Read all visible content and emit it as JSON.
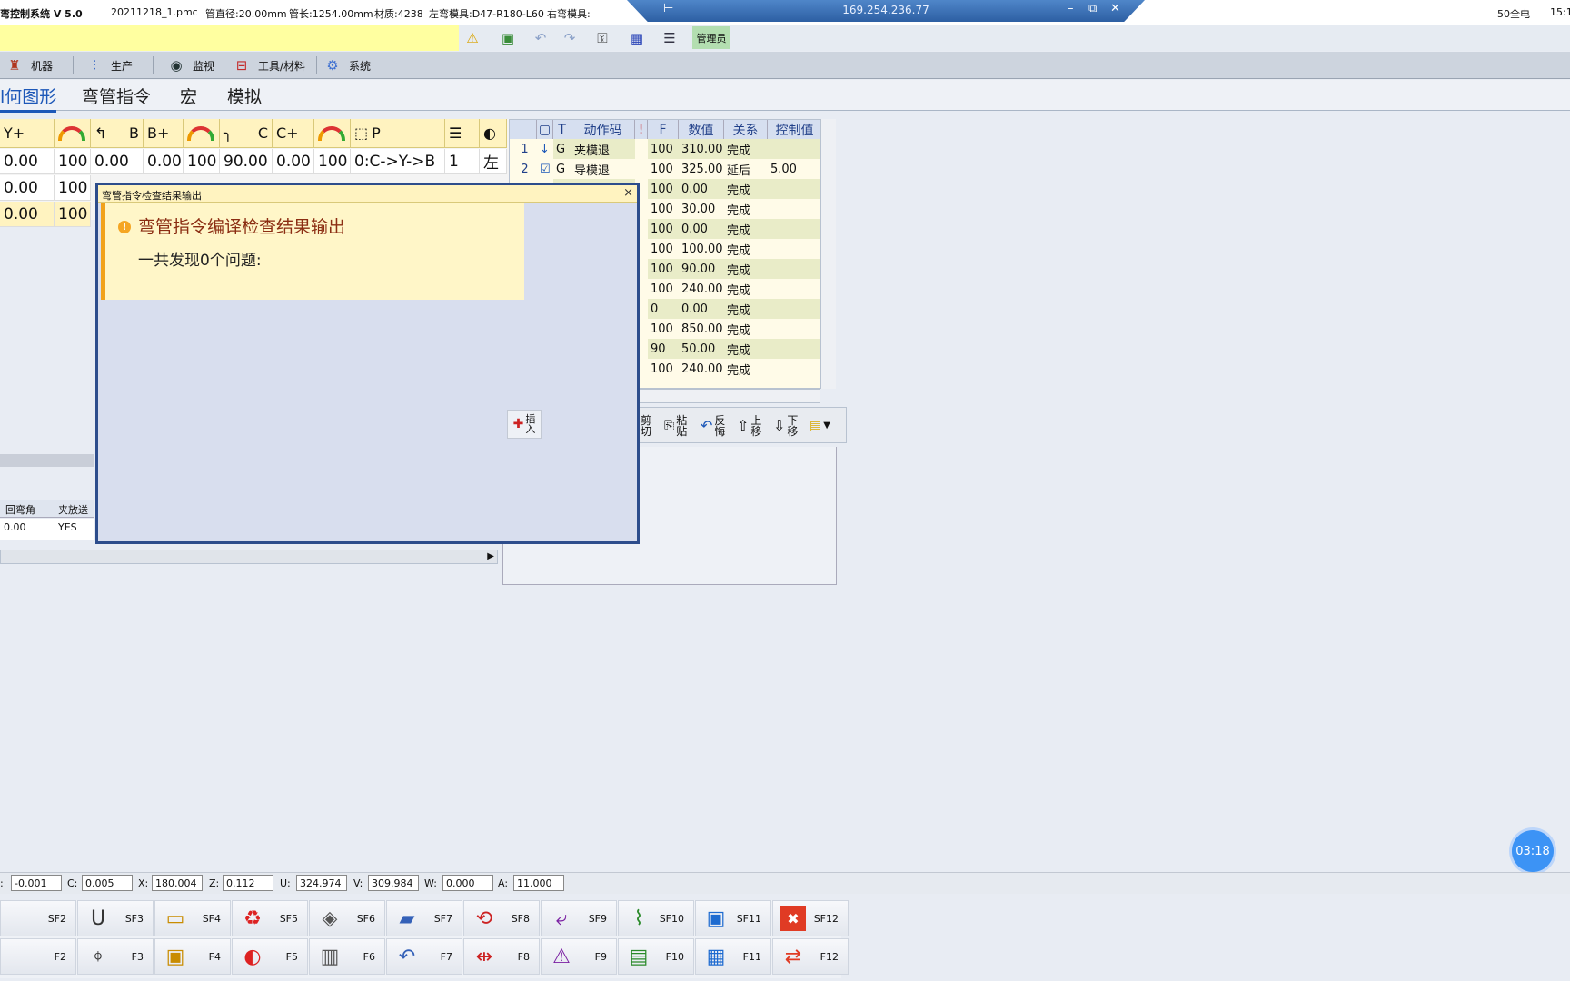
{
  "titlebar": {
    "app": "弯控制系统 V 5.0",
    "file": "20211218_1.pmc",
    "diameter": "管直径:20.00mm",
    "length": "管长:1254.00mm",
    "material": "材质:4238",
    "left_die": "左弯模具:D47-R180-L60",
    "right_die": "右弯模具:",
    "remote_ip": "169.254.236.77",
    "right_status": "50全电",
    "clock": "15:1"
  },
  "toolbar": {
    "admin_label": "管理员"
  },
  "menu": [
    {
      "label": "机器",
      "icon": "machine-icon"
    },
    {
      "label": "生产",
      "icon": "production-icon"
    },
    {
      "label": "监视",
      "icon": "eye-icon"
    },
    {
      "label": "工具/材料",
      "icon": "tools-icon"
    },
    {
      "label": "系统",
      "icon": "gear-icon"
    }
  ],
  "tabs": [
    "几何图形",
    "弯管指令",
    "宏",
    "模拟"
  ],
  "tabs_visible": [
    "几何图形",
    "弯管指令",
    "宏",
    "模拟"
  ],
  "tab_first_visible": "l何图形",
  "grid": {
    "headers": [
      "Y+",
      "",
      "B",
      "B+",
      "",
      "C",
      "C+",
      "",
      "P",
      "",
      ""
    ],
    "rows": [
      [
        "0.00",
        "100",
        "0.00",
        "0.00",
        "100",
        "90.00",
        "0.00",
        "100",
        "0:C->Y->B",
        "1",
        "左"
      ],
      [
        "0.00",
        "100"
      ],
      [
        "0.00",
        "100"
      ]
    ]
  },
  "rtable": {
    "headers": [
      "",
      "",
      "T",
      "动作码",
      "!",
      "F",
      "数值",
      "关系",
      "控制值"
    ],
    "rows": [
      {
        "no": "1",
        "t": "G",
        "code": "夹模退",
        "f": "100",
        "val": "310.00",
        "rel": "完成",
        "ctl": ""
      },
      {
        "no": "2",
        "t": "G",
        "code": "导模退",
        "f": "100",
        "val": "325.00",
        "rel": "延后",
        "ctl": "5.00"
      },
      {
        "no": "",
        "t": "",
        "code": "",
        "f": "100",
        "val": "0.00",
        "rel": "完成",
        "ctl": ""
      },
      {
        "no": "",
        "t": "",
        "code": "",
        "f": "100",
        "val": "30.00",
        "rel": "完成",
        "ctl": ""
      },
      {
        "no": "",
        "t": "",
        "code": "",
        "f": "100",
        "val": "0.00",
        "rel": "完成",
        "ctl": ""
      },
      {
        "no": "",
        "t": "",
        "code": "",
        "f": "100",
        "val": "100.00",
        "rel": "完成",
        "ctl": ""
      },
      {
        "no": "",
        "t": "",
        "code": "",
        "f": "100",
        "val": "90.00",
        "rel": "完成",
        "ctl": ""
      },
      {
        "no": "",
        "t": "",
        "code": "",
        "f": "100",
        "val": "240.00",
        "rel": "完成",
        "ctl": ""
      },
      {
        "no": "",
        "t": "",
        "code": "",
        "f": "0",
        "val": "0.00",
        "rel": "完成",
        "ctl": ""
      },
      {
        "no": "",
        "t": "",
        "code": "",
        "f": "100",
        "val": "850.00",
        "rel": "完成",
        "ctl": ""
      },
      {
        "no": "",
        "t": "",
        "code": "",
        "f": "90",
        "val": "50.00",
        "rel": "完成",
        "ctl": ""
      },
      {
        "no": "",
        "t": "",
        "code": "",
        "f": "100",
        "val": "240.00",
        "rel": "完成",
        "ctl": ""
      }
    ]
  },
  "edit_toolbar": {
    "cut": [
      "剪",
      "切"
    ],
    "paste": [
      "粘",
      "贴"
    ],
    "undo": [
      "反",
      "悔"
    ],
    "up": [
      "上",
      "移"
    ],
    "down": [
      "下",
      "移"
    ]
  },
  "small_table": {
    "headers": [
      "回弯角",
      "夹放送"
    ],
    "row": [
      "0.00",
      "YES"
    ]
  },
  "dialog": {
    "title": "弯管指令检查结果输出",
    "heading": "弯管指令编译检查结果输出",
    "body": "一共发现0个问题:",
    "insert_label": [
      "插",
      "入"
    ]
  },
  "timer": "03:18",
  "coords": [
    {
      "label": ":",
      "value": "-0.001"
    },
    {
      "label": "C:",
      "value": "0.005"
    },
    {
      "label": "X:",
      "value": "180.004"
    },
    {
      "label": "Z:",
      "value": "0.112"
    },
    {
      "label": "U:",
      "value": "324.974"
    },
    {
      "label": "V:",
      "value": "309.984"
    },
    {
      "label": "W:",
      "value": "0.000"
    },
    {
      "label": "A:",
      "value": "11.000"
    }
  ],
  "fkeys_top": [
    "SF2",
    "SF3",
    "SF4",
    "SF5",
    "SF6",
    "SF7",
    "SF8",
    "SF9",
    "SF10",
    "SF11",
    "SF12"
  ],
  "fkeys_bottom": [
    "F2",
    "F3",
    "F4",
    "F5",
    "F6",
    "F7",
    "F8",
    "F9",
    "F10",
    "F11",
    "F12"
  ],
  "colors": {
    "accent": "#1d58b8",
    "highlight": "#fff3c0",
    "warn": "#f1a21b",
    "dialog_border": "#2d4d8c"
  }
}
